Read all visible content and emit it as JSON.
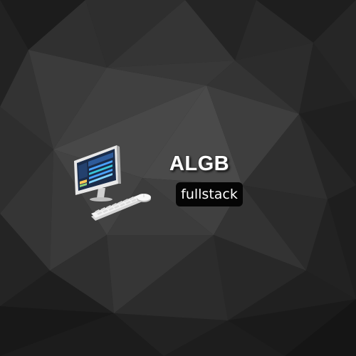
{
  "brand": {
    "title": "ALGB",
    "tagline": "fullstack"
  },
  "illustration": {
    "icon": "desktop-computer-icon",
    "screen_icon": "dashboard-icon",
    "keyboard_icon": "keyboard-icon",
    "mouse_icon": "mouse-icon"
  },
  "colors": {
    "background": "#2a2a2a",
    "title_text": "#ffffff",
    "tag_background": "#050505",
    "tag_text": "#ffffff",
    "screen_accent": "#1e88e5"
  }
}
